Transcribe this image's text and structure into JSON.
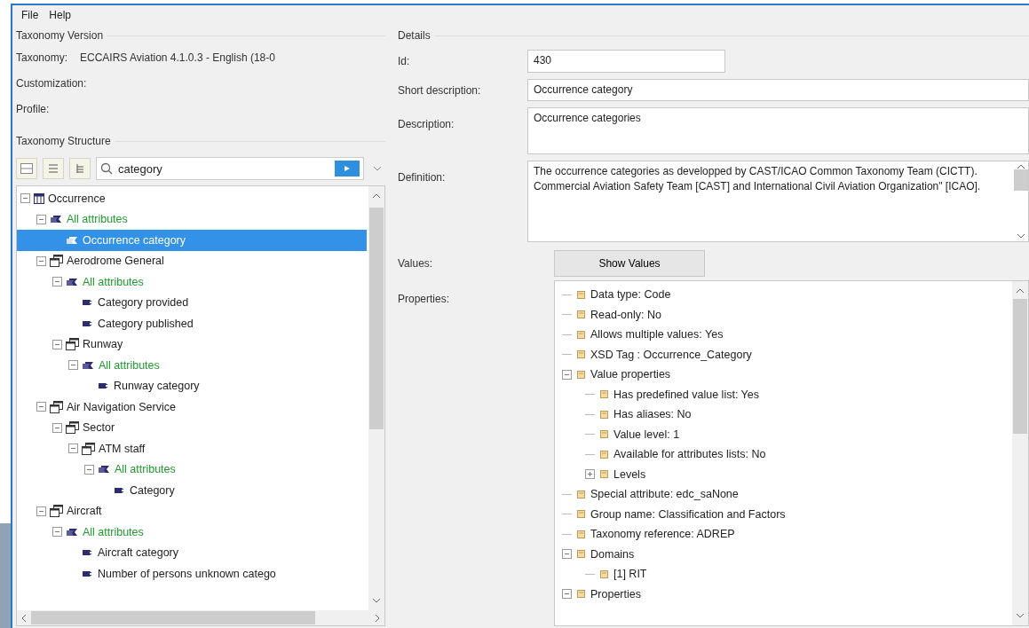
{
  "menu": [
    "File",
    "Help"
  ],
  "taxonomy_version": {
    "title": "Taxonomy Version",
    "fields": [
      {
        "label": "Taxonomy:",
        "value": "ECCAIRS Aviation 4.1.0.3 - English (18-0"
      },
      {
        "label": "Customization:"
      },
      {
        "label": "Profile:"
      }
    ]
  },
  "taxonomy_structure": {
    "title": "Taxonomy Structure",
    "search": {
      "value": "category"
    },
    "tree": [
      {
        "label": "Occurrence",
        "kind": "table",
        "selected": false,
        "expanded": true,
        "children": [
          {
            "label": "All attributes",
            "kind": "attributes",
            "selected": false,
            "expanded": true,
            "children": [
              {
                "label": "Occurrence category",
                "kind": "attributes",
                "selected": true
              }
            ]
          },
          {
            "label": "Aerodrome General",
            "kind": "entity",
            "selected": false,
            "expanded": true,
            "children": [
              {
                "label": "All attributes",
                "kind": "attributes",
                "selected": false,
                "expanded": true,
                "children": [
                  {
                    "label": "Category provided",
                    "kind": "attribute",
                    "selected": false
                  },
                  {
                    "label": "Category published",
                    "kind": "attribute",
                    "selected": false
                  }
                ]
              },
              {
                "label": "Runway",
                "kind": "entity",
                "selected": false,
                "expanded": true,
                "children": [
                  {
                    "label": "All attributes",
                    "kind": "attributes",
                    "selected": false,
                    "expanded": true,
                    "children": [
                      {
                        "label": "Runway category",
                        "kind": "attribute",
                        "selected": false
                      }
                    ]
                  }
                ]
              }
            ]
          },
          {
            "label": "Air Navigation Service",
            "kind": "entity",
            "selected": false,
            "expanded": true,
            "children": [
              {
                "label": "Sector",
                "kind": "entity",
                "selected": false,
                "expanded": true,
                "children": [
                  {
                    "label": "ATM staff",
                    "kind": "entity",
                    "selected": false,
                    "expanded": true,
                    "children": [
                      {
                        "label": "All attributes",
                        "kind": "attributes",
                        "selected": false,
                        "expanded": true,
                        "children": [
                          {
                            "label": "Category",
                            "kind": "attribute",
                            "selected": false
                          }
                        ]
                      }
                    ]
                  }
                ]
              }
            ]
          },
          {
            "label": "Aircraft",
            "kind": "entity",
            "selected": false,
            "expanded": true,
            "children": [
              {
                "label": "All attributes",
                "kind": "attributes",
                "selected": false,
                "expanded": true,
                "children": [
                  {
                    "label": "Aircraft category",
                    "kind": "attribute",
                    "selected": false
                  },
                  {
                    "label": "Number of persons unknown catego",
                    "kind": "attribute",
                    "selected": false
                  }
                ]
              }
            ]
          }
        ]
      }
    ]
  },
  "details": {
    "title": "Details",
    "id": {
      "label": "Id:",
      "value": "430"
    },
    "short_description": {
      "label": "Short description:",
      "value": "Occurrence category"
    },
    "description": {
      "label": "Description:",
      "value": "Occurrence categories"
    },
    "definition": {
      "label": "Definition:",
      "value": "The occurrence categories as developped by CAST/ICAO Common Taxonomy Team (CICTT). Commercial Aviation Safety Team [CAST] and International Civil Aviation Organization\" [ICAO]."
    },
    "values": {
      "label": "Values:",
      "button": "Show Values"
    },
    "properties": {
      "label": "Properties:",
      "tree": [
        {
          "label": "Data type: Code"
        },
        {
          "label": "Read-only: No"
        },
        {
          "label": "Allows multiple values: Yes"
        },
        {
          "label": "XSD Tag : Occurrence_Category"
        },
        {
          "label": "Value properties",
          "expanded": true,
          "children": [
            {
              "label": "Has predefined value list: Yes"
            },
            {
              "label": "Has aliases: No"
            },
            {
              "label": "Value level: 1"
            },
            {
              "label": "Available for attributes lists: No"
            },
            {
              "label": "Levels",
              "expanded": false
            }
          ]
        },
        {
          "label": "Special attribute: edc_saNone"
        },
        {
          "label": "Group name: Classification and Factors"
        },
        {
          "label": "Taxonomy reference: ADREP"
        },
        {
          "label": "Domains",
          "expanded": true,
          "children": [
            {
              "label": "[1] RIT"
            }
          ]
        },
        {
          "label": "Properties",
          "expanded": true
        }
      ]
    }
  }
}
